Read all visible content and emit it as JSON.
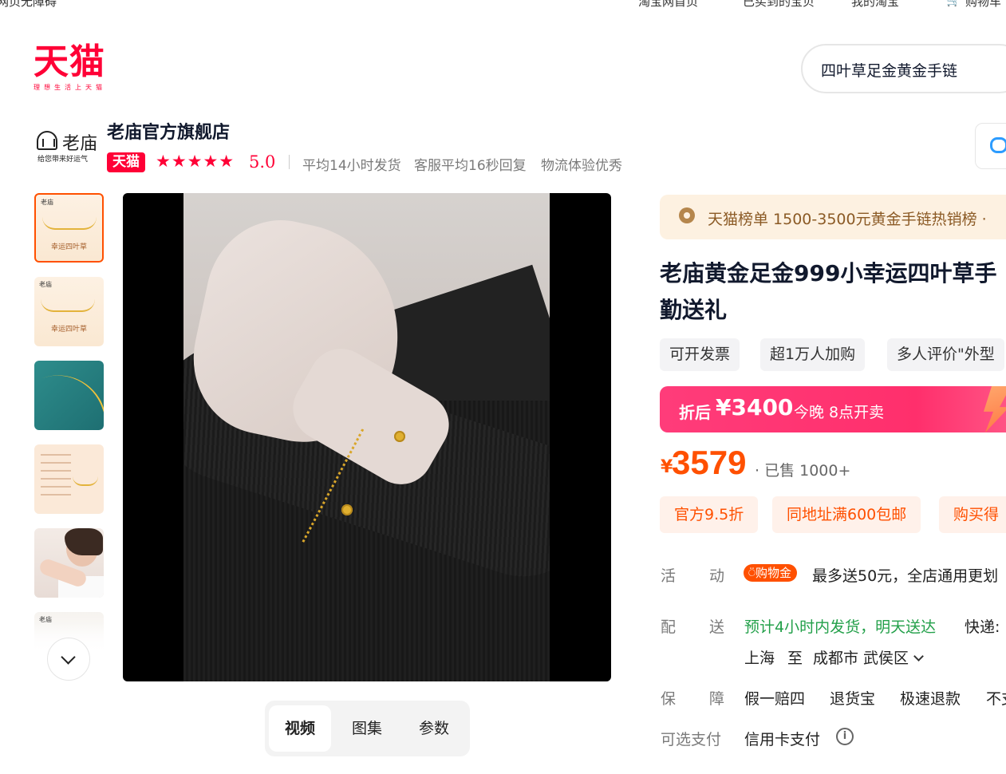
{
  "top_nav": {
    "accessibility": "网页无障碍",
    "home": "淘宝网首页",
    "bought": "已买到的宝贝",
    "my_taobao": "我的淘宝",
    "cart": "购物车"
  },
  "logo": {
    "text": "天猫",
    "slogan": "理想生活上天猫"
  },
  "search": {
    "value": "四叶草足金黄金手链"
  },
  "store": {
    "logo_name": "老庙",
    "logo_slogan": "给您带来好运气",
    "name": "老庙官方旗舰店",
    "badge": "天猫",
    "stars": "★★★★★",
    "rating": "5.0",
    "stats": [
      "平均14小时发货",
      "客服平均16秒回复",
      "物流体验优秀"
    ]
  },
  "thumbnails": [
    {
      "label": "幸运四叶草",
      "brand": "老庙"
    },
    {
      "label": "幸运四叶草",
      "brand": "老庙"
    },
    {
      "label": ""
    },
    {
      "label": ""
    },
    {
      "label": ""
    },
    {
      "label": "",
      "brand": "老庙"
    }
  ],
  "media_tabs": [
    "视频",
    "图集",
    "参数"
  ],
  "rank": {
    "text": "天猫榜单 1500-3500元黄金手链热销榜 ·"
  },
  "product": {
    "title_line1": "老庙黄金足金999小幸运四叶草手",
    "title_line2": "勤送礼"
  },
  "tags": [
    "可开发票",
    "超1万人加购",
    "多人评价\"外型"
  ],
  "promo": {
    "label": "折后",
    "price": "¥3400",
    "sale_time": "今晚 8点开卖"
  },
  "price": {
    "symbol": "¥",
    "value": "3579",
    "sold": "· 已售 1000+"
  },
  "coupons": [
    "官方9.5折",
    "同地址满600包邮",
    "购买得"
  ],
  "activity": {
    "label_a": "活",
    "label_b": "动",
    "badge": "购物金",
    "text": "最多送50元，全店通用更划"
  },
  "delivery": {
    "label_a": "配",
    "label_b": "送",
    "eta": "预计4小时内发货，明天送达",
    "courier": "快递:",
    "from": "上海",
    "to_word": "至",
    "dest": "成都市 武侯区"
  },
  "guarantee": {
    "label_a": "保",
    "label_b": "障",
    "items": [
      "假一赔四",
      "退货宝",
      "极速退款",
      "不支"
    ]
  },
  "payment": {
    "label": "可选支付",
    "value": "信用卡支付",
    "info": "i"
  },
  "colors": {
    "brand": "#ff0036",
    "price": "#ff5000",
    "promo": "#ff2f6c",
    "green": "#23a04a"
  }
}
